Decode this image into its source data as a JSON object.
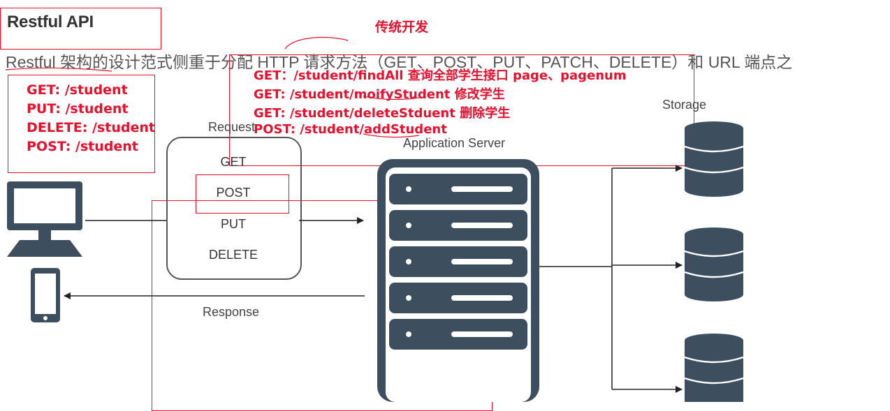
{
  "header": {
    "title": "Restful API",
    "description": "Restful 架构的设计范式侧重于分配 HTTP 请求方法（GET、POST、PUT、PATCH、DELETE）和 URL 端点之"
  },
  "annotations": {
    "traditional_label": "传统开发",
    "traditional_endpoints": [
      "GET：/student/findAll  查询全部学生接口  page、pagenum",
      "GET: /student/moifyStudent 修改学生",
      "GET: /student/deleteStduent 删除学生",
      "POST: /student/addStudent"
    ],
    "restful_endpoints": [
      "GET: /student",
      "PUT: /student",
      "DELETE: /student",
      "POST: /student"
    ]
  },
  "diagram": {
    "request_label": "Request",
    "response_label": "Response",
    "server_label": "Application Server",
    "storage_label": "Storage",
    "methods": [
      "GET",
      "POST",
      "PUT",
      "DELETE"
    ]
  },
  "colors": {
    "annotation": "#e8112d",
    "icon": "#3d4f5f",
    "text": "#444444"
  }
}
